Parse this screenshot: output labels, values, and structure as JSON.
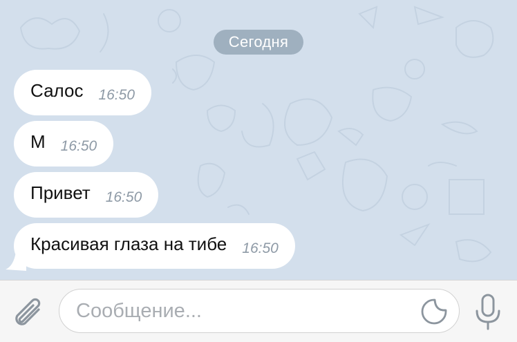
{
  "chat": {
    "date_label": "Сегодня",
    "messages": [
      {
        "text": "Салос",
        "time": "16:50"
      },
      {
        "text": "М",
        "time": "16:50"
      },
      {
        "text": "Привет",
        "time": "16:50"
      },
      {
        "text": "Красивая глаза на тибе",
        "time": "16:50"
      }
    ]
  },
  "composer": {
    "placeholder": "Сообщение...",
    "attach_icon": "paperclip-icon",
    "sticker_icon": "sticker-icon",
    "mic_icon": "microphone-icon"
  },
  "colors": {
    "wallpaper": "#d3dfec",
    "bubble": "#ffffff",
    "date_pill": "#9fb0bf",
    "time_text": "#8e9aa6",
    "icon": "#8c959e"
  }
}
